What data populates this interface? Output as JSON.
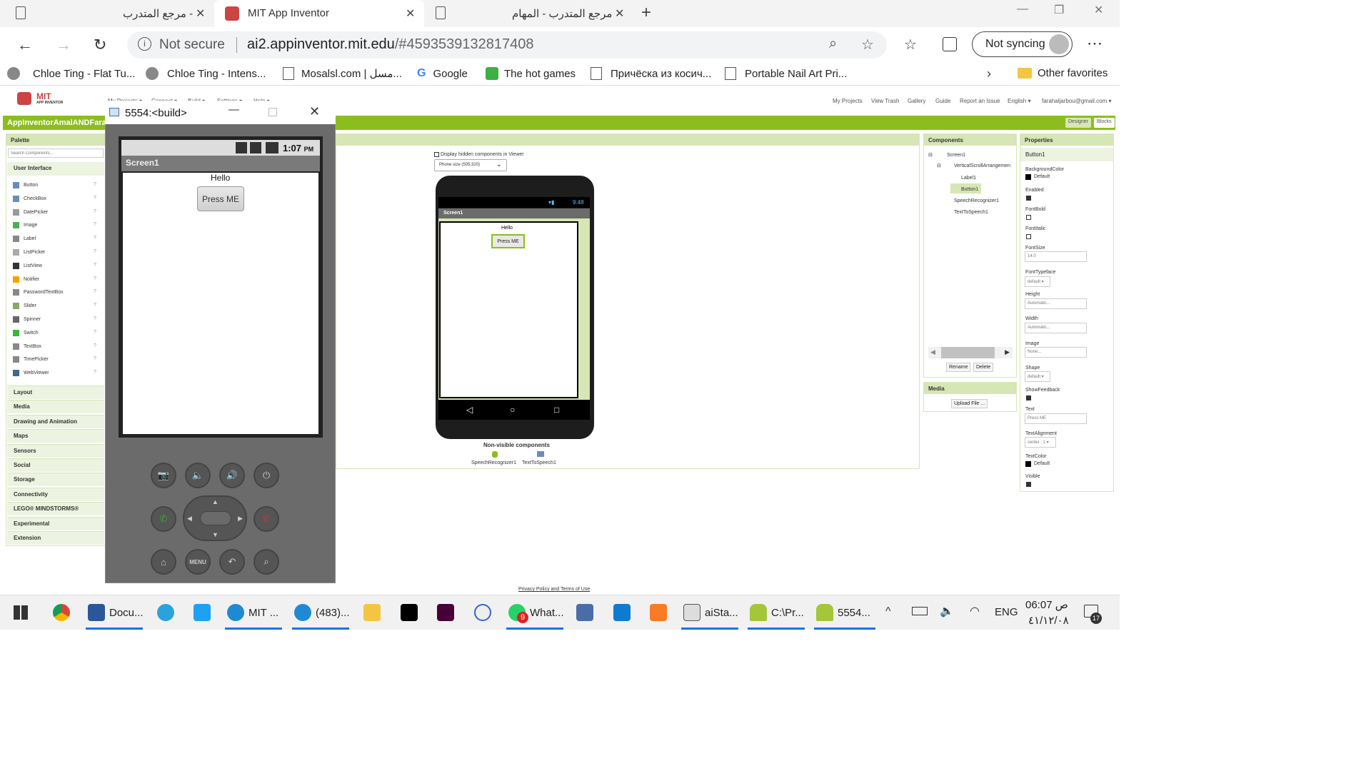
{
  "browser": {
    "tabs": [
      {
        "title": "مرجع المتدرب -"
      },
      {
        "title": "MIT App Inventor"
      },
      {
        "title": "مرجع المتدرب - المهام"
      }
    ],
    "not_secure": "Not secure",
    "url_host": "ai2.appinventor.mit.edu",
    "url_hash": "/#4593539132817408",
    "sync_label": "Not syncing",
    "bookmarks": [
      "Chloe Ting - Flat Tu...",
      "Chloe Ting - Intens...",
      "Mosalsl.com | مسل...",
      "Google",
      "The hot games",
      "Причёска из косич...",
      "Portable Nail Art Pri..."
    ],
    "other_favorites": "Other favorites"
  },
  "app": {
    "logo_mit": "MIT",
    "logo_sub": "APP INVENTOR",
    "menus": [
      "My Projects ▾",
      "Connect ▾",
      "Build ▾",
      "Settings ▾",
      "Help ▾"
    ],
    "top_links": [
      "My Projects",
      "View Trash",
      "Gallery",
      "Guide",
      "Report an Issue",
      "English ▾",
      "farahaljarbou@gmail.com ▾"
    ],
    "project_name": "AppInventorAmalANDFarah",
    "designer_btn": "Designer",
    "blocks_btn": "Blocks",
    "palette": {
      "title": "Palette",
      "search_placeholder": "Search Components...",
      "section": "User Interface",
      "items": [
        "Button",
        "CheckBox",
        "DatePicker",
        "Image",
        "Label",
        "ListPicker",
        "ListView",
        "Notifier",
        "PasswordTextBox",
        "Slider",
        "Spinner",
        "Switch",
        "TextBox",
        "TimePicker",
        "WebViewer"
      ],
      "categories": [
        "Layout",
        "Media",
        "Drawing and Animation",
        "Maps",
        "Sensors",
        "Social",
        "Storage",
        "Connectivity",
        "LEGO® MINDSTORMS®",
        "Experimental",
        "Extension"
      ]
    },
    "viewer": {
      "display_hidden": "Display hidden components in Viewer",
      "phone_size": "Phone size (505,320)",
      "status_time": "9:48",
      "screen_title": "Screen1",
      "label_text": "Hello",
      "button_text": "Press ME",
      "nonvisible_title": "Non-visible components",
      "nonvisible": [
        "SpeechRecognizer1",
        "TextToSpeech1"
      ]
    },
    "components": {
      "title": "Components",
      "tree": [
        "Screen1",
        "VerticalScrollArrangemen",
        "Label1",
        "Button1",
        "SpeechRecognizer1",
        "TextToSpeech1"
      ],
      "rename": "Rename",
      "delete": "Delete"
    },
    "media": {
      "title": "Media",
      "upload": "Upload File ..."
    },
    "properties": {
      "title": "Properties",
      "component": "Button1",
      "background_color_label": "BackgroundColor",
      "background_color_value": "Default",
      "enabled_label": "Enabled",
      "font_bold_label": "FontBold",
      "font_italic_label": "FontItalic",
      "font_size_label": "FontSize",
      "font_size_value": "14.0",
      "font_typeface_label": "FontTypeface",
      "font_typeface_value": "default ▾",
      "height_label": "Height",
      "height_value": "Automatic...",
      "width_label": "Width",
      "width_value": "Automatic...",
      "image_label": "Image",
      "image_value": "None...",
      "shape_label": "Shape",
      "shape_value": "default ▾",
      "show_feedback_label": "ShowFeedback",
      "text_label": "Text",
      "text_value": "Press ME",
      "text_alignment_label": "TextAlignment",
      "text_alignment_value": "center : 1 ▾",
      "text_color_label": "TextColor",
      "text_color_value": "Default",
      "visible_label": "Visible"
    },
    "footer": "Privacy Policy and Terms of Use"
  },
  "emulator": {
    "title": "5554:<build>",
    "status_time": "1:07",
    "status_ampm": "PM",
    "screen_title": "Screen1",
    "label_text": "Hello",
    "button_text": "Press ME",
    "menu_label": "MENU"
  },
  "taskbar": {
    "items": [
      "Docu...",
      "MIT ...",
      "(483)...",
      "What...",
      "aiSta...",
      "C:\\Pr...",
      "5554..."
    ],
    "whatsapp_badge": "9",
    "lang": "ENG",
    "time": "06:07 ص",
    "date": "٤١/١٢/٠٨",
    "notif_count": "17"
  },
  "colors": {
    "accent_green": "#8cbd1f",
    "panel_green": "#d6e6b4",
    "edge_blue": "#1a73e8"
  }
}
